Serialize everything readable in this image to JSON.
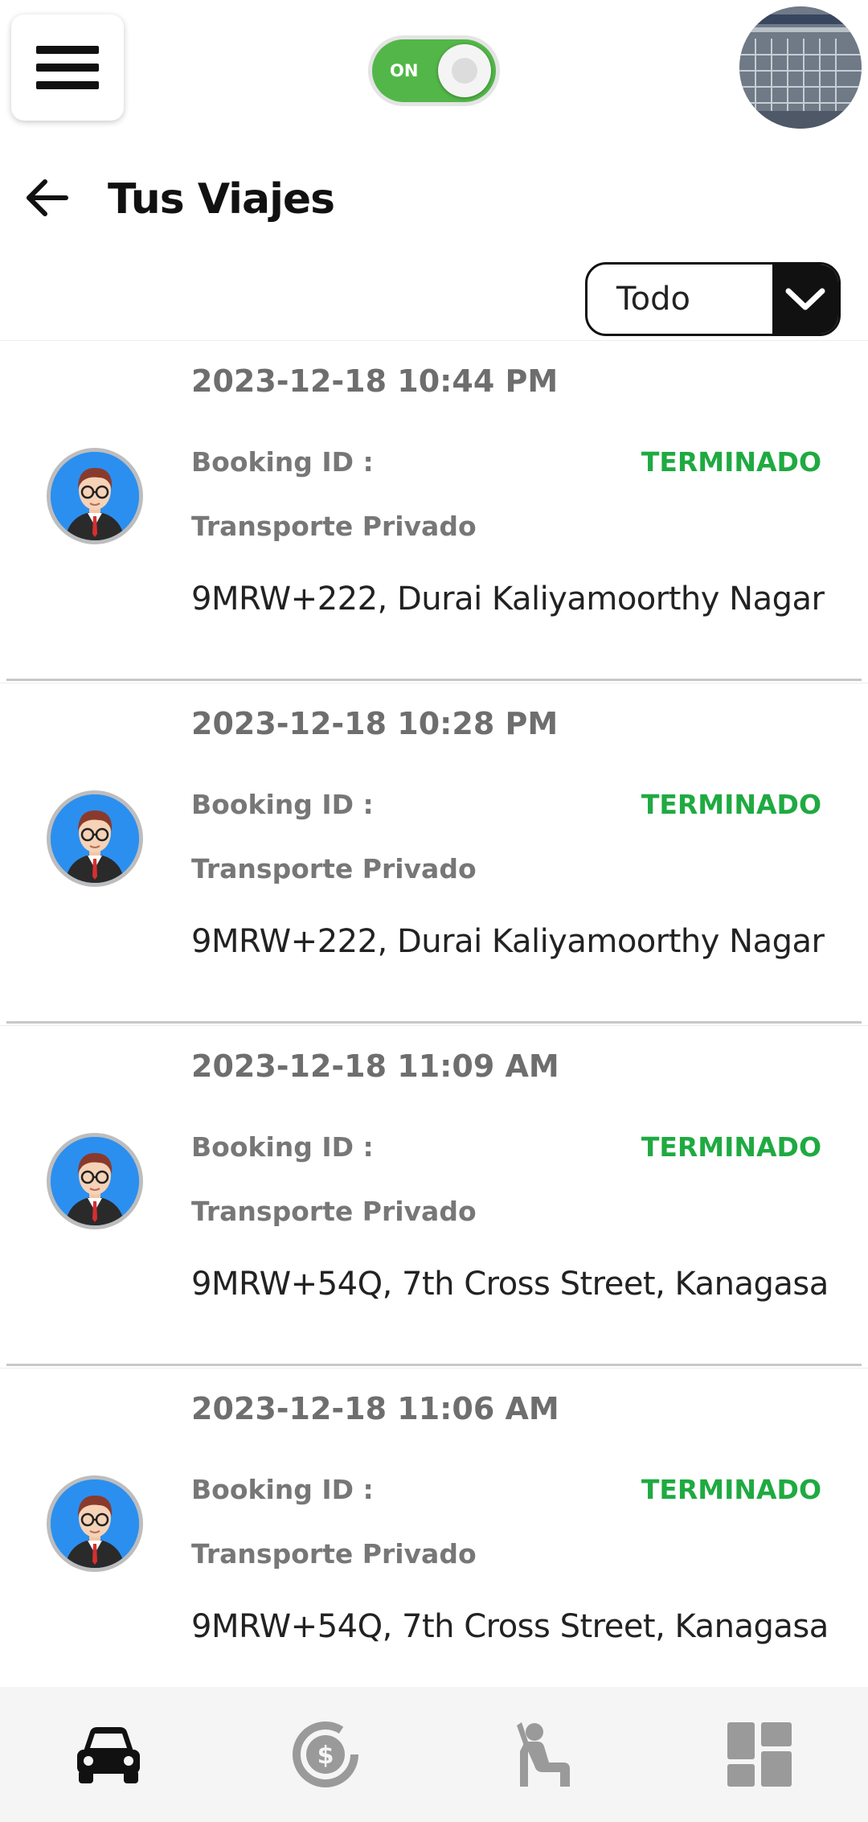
{
  "header": {
    "menu_icon": "hamburger-menu-icon",
    "status_toggle": {
      "label": "ON",
      "state": "on",
      "color": "#52b748"
    },
    "profile_icon": "profile-photo"
  },
  "page": {
    "back_icon": "arrow-left-icon",
    "title": "Tus Viajes"
  },
  "filter": {
    "selected": "Todo",
    "icon": "chevron-down-icon"
  },
  "colors": {
    "status_completed": "#1faa41",
    "toggle_on": "#52b748",
    "nav_active": "#111111",
    "nav_inactive": "#9a9a9a"
  },
  "trips": [
    {
      "datetime": "2023-12-18 10:44 PM",
      "booking_label": "Booking ID :",
      "status": "TERMINADO",
      "service": "Transporte Privado",
      "address": "9MRW+222, Durai Kaliyamoorthy Nagar, ...",
      "avatar_icon": "driver-avatar-icon"
    },
    {
      "datetime": "2023-12-18 10:28 PM",
      "booking_label": "Booking ID :",
      "status": "TERMINADO",
      "service": "Transporte Privado",
      "address": "9MRW+222, Durai Kaliyamoorthy Nagar, ...",
      "avatar_icon": "driver-avatar-icon"
    },
    {
      "datetime": "2023-12-18 11:09 AM",
      "booking_label": "Booking ID :",
      "status": "TERMINADO",
      "service": "Transporte Privado",
      "address": "9MRW+54Q, 7th Cross Street, Kanagasab...",
      "avatar_icon": "driver-avatar-icon"
    },
    {
      "datetime": "2023-12-18 11:06 AM",
      "booking_label": "Booking ID :",
      "status": "TERMINADO",
      "service": "Transporte Privado",
      "address": "9MRW+54Q, 7th Cross Street, Kanagasab...",
      "avatar_icon": "driver-avatar-icon"
    }
  ],
  "bottom_nav": [
    {
      "icon": "car-icon",
      "active": true
    },
    {
      "icon": "earnings-icon",
      "active": false
    },
    {
      "icon": "passenger-icon",
      "active": false
    },
    {
      "icon": "dashboard-icon",
      "active": false
    }
  ]
}
